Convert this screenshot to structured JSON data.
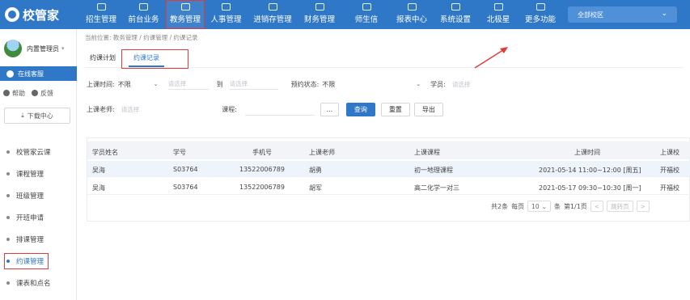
{
  "app": {
    "logo_text": "校管家"
  },
  "nav": {
    "items": [
      {
        "label": "招生管理",
        "icon": "users-icon"
      },
      {
        "label": "前台业务",
        "icon": "desk-icon"
      },
      {
        "label": "教务管理",
        "icon": "book-icon"
      },
      {
        "label": "人事管理",
        "icon": "person-icon"
      },
      {
        "label": "进销存管理",
        "icon": "box-icon"
      },
      {
        "label": "财务管理",
        "icon": "money-icon"
      },
      {
        "label": "师生信",
        "icon": "chat-icon"
      },
      {
        "label": "报表中心",
        "icon": "report-icon"
      },
      {
        "label": "系统设置",
        "icon": "settings-icon"
      },
      {
        "label": "北极星",
        "icon": "star-icon"
      },
      {
        "label": "更多功能",
        "icon": "more-icon"
      }
    ],
    "campus": "全部校区"
  },
  "sidebar": {
    "user_name": "内置管理员",
    "service": "在线客服",
    "help": "帮助",
    "feedback": "反馈",
    "download": "下载中心",
    "menu": [
      "校管家云课",
      "课程管理",
      "班级管理",
      "开班申请",
      "排课管理",
      "约课管理",
      "课表和点名"
    ]
  },
  "main": {
    "breadcrumb": "当前位置: 教务管理 / 约课管理 / 约课记录",
    "tabs": [
      "约课计划",
      "约课记录"
    ],
    "filters": {
      "class_time_label": "上课时间:",
      "class_time_value": "不限",
      "to_label": "到",
      "placeholder": "请选择",
      "status_label": "预约状态:",
      "status_value": "不限",
      "student_label": "学员:",
      "teacher_label": "上课老师:",
      "course_label": "课程:",
      "ellipsis": "...",
      "query": "查询",
      "reset": "重置",
      "export": "导出"
    },
    "table": {
      "headers": [
        "学员姓名",
        "学号",
        "手机号",
        "上课老师",
        "上课课程",
        "上课时间",
        "上课校"
      ],
      "rows": [
        [
          "吴海",
          "S03764",
          "13522006789",
          "胡勇",
          "初一地理课程",
          "2021-05-14 11:00~12:00 [周五]",
          "开福校"
        ],
        [
          "吴海",
          "S03764",
          "13522006789",
          "胡军",
          "高二化学一对三",
          "2021-05-17 09:30~10:30 [周一]",
          "开福校"
        ]
      ]
    },
    "pager": {
      "total": "共2条",
      "per_page_label": "每页",
      "per_page": "10",
      "unit": "条",
      "page": "第1/1页",
      "prev": "<",
      "jump": "跳转页",
      "next": ">"
    }
  }
}
